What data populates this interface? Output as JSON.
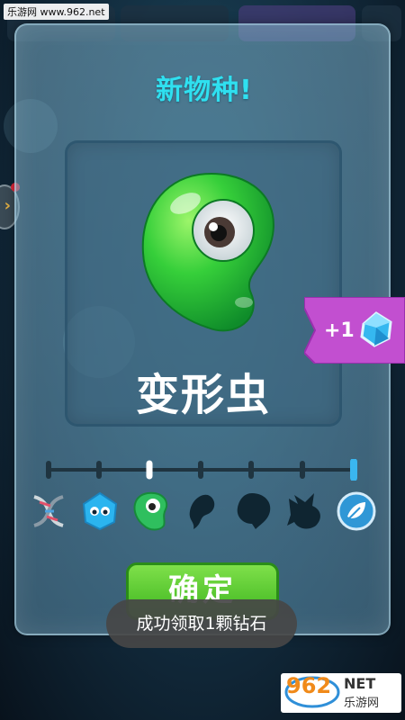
{
  "watermark_top": "乐游网 www.962.net",
  "modal": {
    "title": "新物种!",
    "species_name": "变形虫"
  },
  "reward": {
    "label": "+1",
    "icon": "diamond-icon"
  },
  "progress": {
    "stages": 7,
    "current_stage": 3
  },
  "evolution_icons": [
    "dna-icon",
    "jelly-cube-icon",
    "amoeba-icon",
    "tadpole-silhouette-icon",
    "blob-silhouette-icon",
    "fish-silhouette-icon",
    "leaf-badge-icon"
  ],
  "confirm_label": "确定",
  "toast": "成功领取1颗钻石",
  "watermark_bottom": {
    "number": "962",
    "net": "NET",
    "cn": "乐游网"
  },
  "colors": {
    "title": "#2fe0f0",
    "confirm": "#3db51f",
    "reward_ribbon": "#c24fd0",
    "creature": "#35c93a"
  }
}
